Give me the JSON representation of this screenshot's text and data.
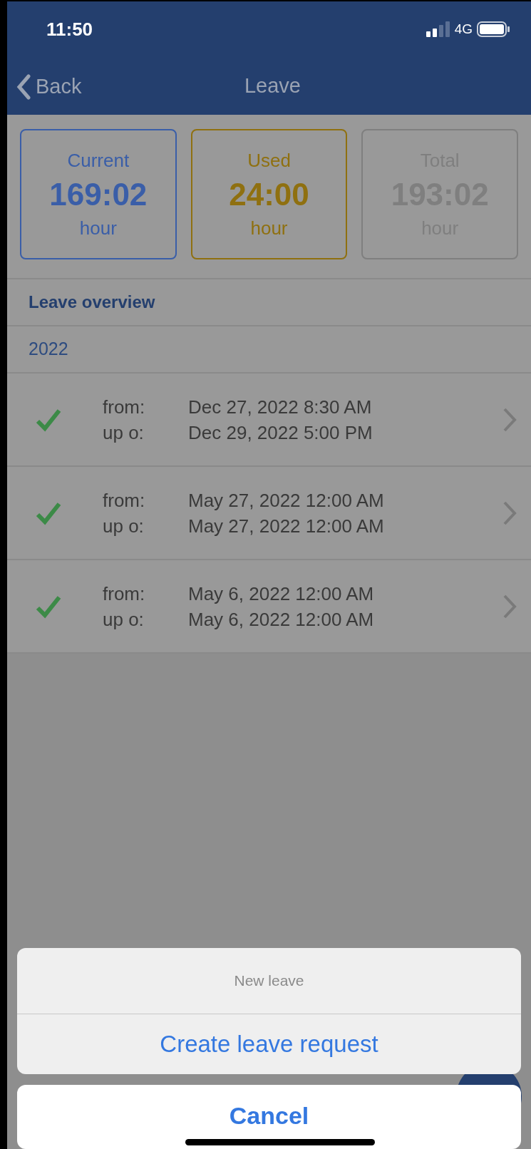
{
  "status_bar": {
    "time": "11:50",
    "network": "4G"
  },
  "nav": {
    "back": "Back",
    "title": "Leave"
  },
  "summary_cards": [
    {
      "label": "Current",
      "value": "169:02",
      "unit": "hour",
      "color": "#3a5ea8"
    },
    {
      "label": "Used",
      "value": "24:00",
      "unit": "hour",
      "color": "#8f7010"
    },
    {
      "label": "Total",
      "value": "193:02",
      "unit": "hour",
      "color": "#7f7f7f"
    }
  ],
  "section_title": "Leave overview",
  "year": "2022",
  "leave_rows": [
    {
      "approved": true,
      "from_label": "from:",
      "from": "Dec 27, 2022 8:30 AM",
      "to_label": "up o:",
      "to": "Dec 29, 2022 5:00 PM"
    },
    {
      "approved": true,
      "from_label": "from:",
      "from": "May 27, 2022 12:00 AM",
      "to_label": "up o:",
      "to": "May 27, 2022 12:00 AM"
    },
    {
      "approved": true,
      "from_label": "from:",
      "from": "May 6, 2022 12:00 AM",
      "to_label": "up o:",
      "to": "May 6, 2022 12:00 AM"
    }
  ],
  "action_sheet": {
    "title": "New leave",
    "actions": [
      "Create leave request"
    ],
    "cancel": "Cancel"
  }
}
